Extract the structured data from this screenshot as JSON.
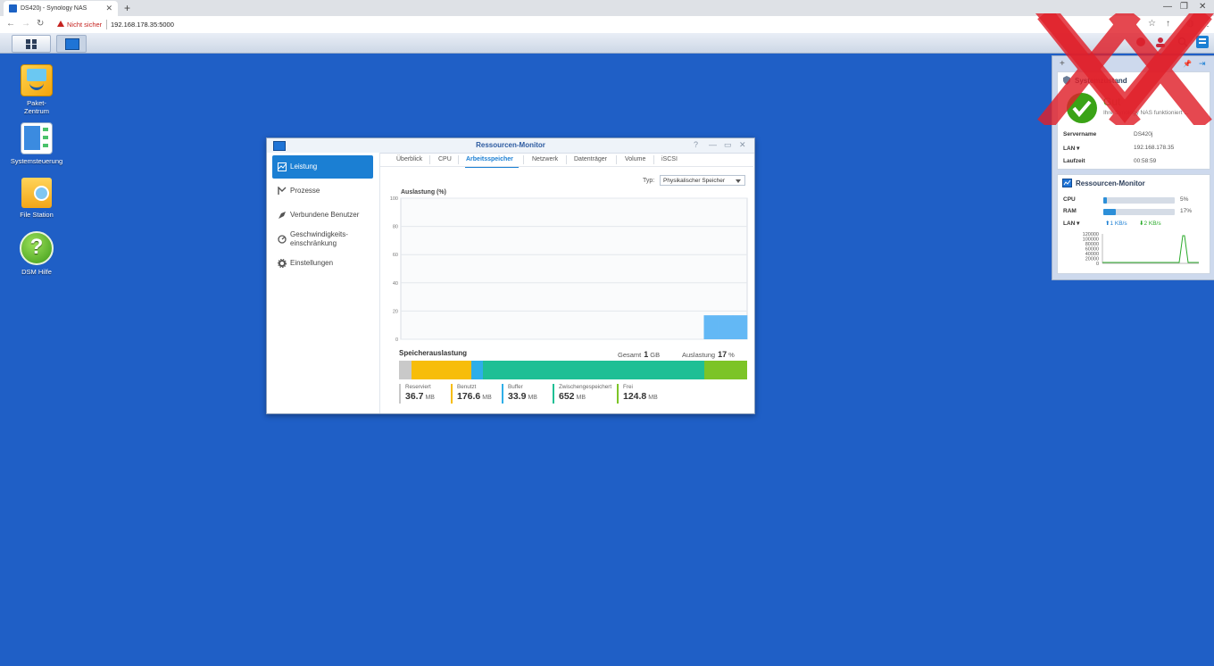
{
  "browser": {
    "tab_title": "DS420j - Synology NAS",
    "not_secure": "Nicht sicher",
    "url": "192.168.178.35:5000"
  },
  "desktop": {
    "icons": [
      {
        "label": "Paket-\nZentrum",
        "icon": "package-center-icon"
      },
      {
        "label": "Systemsteuerung",
        "icon": "control-panel-icon"
      },
      {
        "label": "File Station",
        "icon": "file-station-icon"
      },
      {
        "label": "DSM Hilfe",
        "icon": "help-icon"
      }
    ]
  },
  "window": {
    "title": "Ressourcen-Monitor",
    "sidebar": [
      {
        "label": "Leistung",
        "icon": "performance-icon",
        "active": true
      },
      {
        "label": "Prozesse",
        "icon": "process-icon"
      },
      {
        "label": "Verbundene Benutzer",
        "icon": "users-icon"
      },
      {
        "label": "Geschwindigkeits-\neinschränkung",
        "icon": "speed-limit-icon"
      },
      {
        "label": "Einstellungen",
        "icon": "settings-icon"
      }
    ],
    "tabs": [
      "Überblick",
      "CPU",
      "Arbeitsspeicher",
      "Netzwerk",
      "Datenträger",
      "Volume",
      "iSCSI"
    ],
    "active_tab": "Arbeitsspeicher",
    "type_label": "Typ:",
    "type_value": "Physikalischer Speicher",
    "chart_label": "Auslastung (%)",
    "memory_title": "Speicherauslastung",
    "total_label": "Gesamt",
    "total_value": "1",
    "total_unit": "GB",
    "usage_label": "Auslastung",
    "usage_value": "17",
    "usage_unit": "%",
    "segments": [
      {
        "name": "Reserviert",
        "value": "36.7",
        "unit": "MB",
        "color": "#c9c9c9",
        "mb": 36.7
      },
      {
        "name": "Benutzt",
        "value": "176.6",
        "unit": "MB",
        "color": "#f7bd0a",
        "mb": 176.6
      },
      {
        "name": "Buffer",
        "value": "33.9",
        "unit": "MB",
        "color": "#2eaee8",
        "mb": 33.9
      },
      {
        "name": "Zwischengespeichert",
        "value": "652",
        "unit": "MB",
        "color": "#1fbf95",
        "mb": 652
      },
      {
        "name": "Frei",
        "value": "124.8",
        "unit": "MB",
        "color": "#7cc427",
        "mb": 124.8
      }
    ]
  },
  "chart_data": {
    "type": "area",
    "ylabel": "Auslastung (%)",
    "ylim": [
      0,
      100
    ],
    "yticks": [
      "0",
      "20",
      "40",
      "60",
      "80",
      "100"
    ],
    "grid": true,
    "series": [
      {
        "values": [
          0,
          0,
          0,
          0,
          0,
          0,
          0,
          0,
          0,
          0,
          0,
          0,
          0,
          0,
          0,
          0,
          0,
          0,
          0,
          0,
          0,
          17,
          17,
          17
        ]
      }
    ]
  },
  "widgets": {
    "system": {
      "title": "Systemzustand",
      "status": "Gut",
      "status_text": "Ihre Synology NAS funktioniert ...",
      "rows": [
        {
          "k": "Servername",
          "v": "DS420j"
        },
        {
          "k": "LAN ▾",
          "v": "192.168.178.35"
        },
        {
          "k": "Laufzeit",
          "v": "00:58:59"
        }
      ]
    },
    "monitor": {
      "title": "Ressourcen-Monitor",
      "cpu_label": "CPU",
      "cpu_pct": "5%",
      "cpu_val": 5,
      "ram_label": "RAM",
      "ram_pct": "17%",
      "ram_val": 17,
      "lan_label": "LAN ▾",
      "up": "⬆1 KB/s",
      "down": "⬇2 KB/s",
      "yticks": [
        "120000",
        "100000",
        "80000",
        "60000",
        "40000",
        "20000",
        "0"
      ]
    }
  },
  "colors": {
    "accent": "#1b7fd3",
    "desktop": "#1f5fc6"
  }
}
